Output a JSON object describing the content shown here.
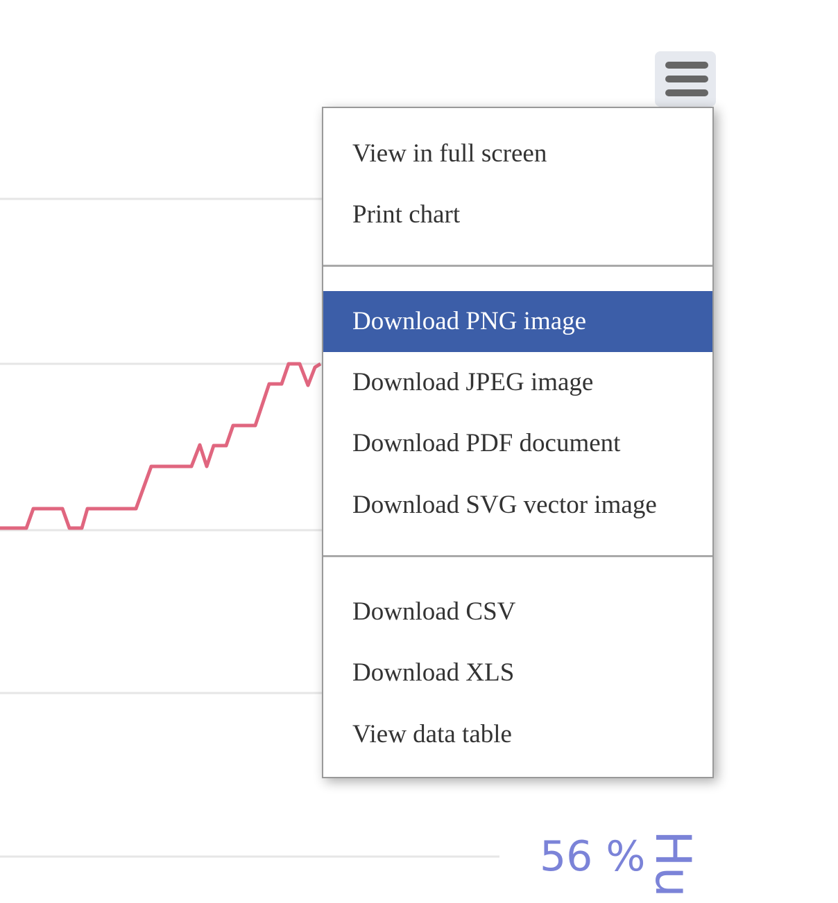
{
  "chart_data": {
    "type": "line",
    "series_color": "#e0667f",
    "grid": true,
    "y_tick_label_visible": "56 %",
    "axis_title_partial": "Hu"
  },
  "menu_button": {
    "icon": "hamburger-menu-icon"
  },
  "context_menu": {
    "groups": [
      [
        {
          "label": "View in full screen"
        },
        {
          "label": "Print chart"
        }
      ],
      [
        {
          "label": "Download PNG image",
          "active": true
        },
        {
          "label": "Download JPEG image"
        },
        {
          "label": "Download PDF document"
        },
        {
          "label": "Download SVG vector image"
        }
      ],
      [
        {
          "label": "Download CSV"
        },
        {
          "label": "Download XLS"
        },
        {
          "label": "View data table"
        }
      ]
    ]
  },
  "colors": {
    "highlight": "#3c5ea8",
    "axis_label": "#7b83d8",
    "line": "#e0667f"
  }
}
